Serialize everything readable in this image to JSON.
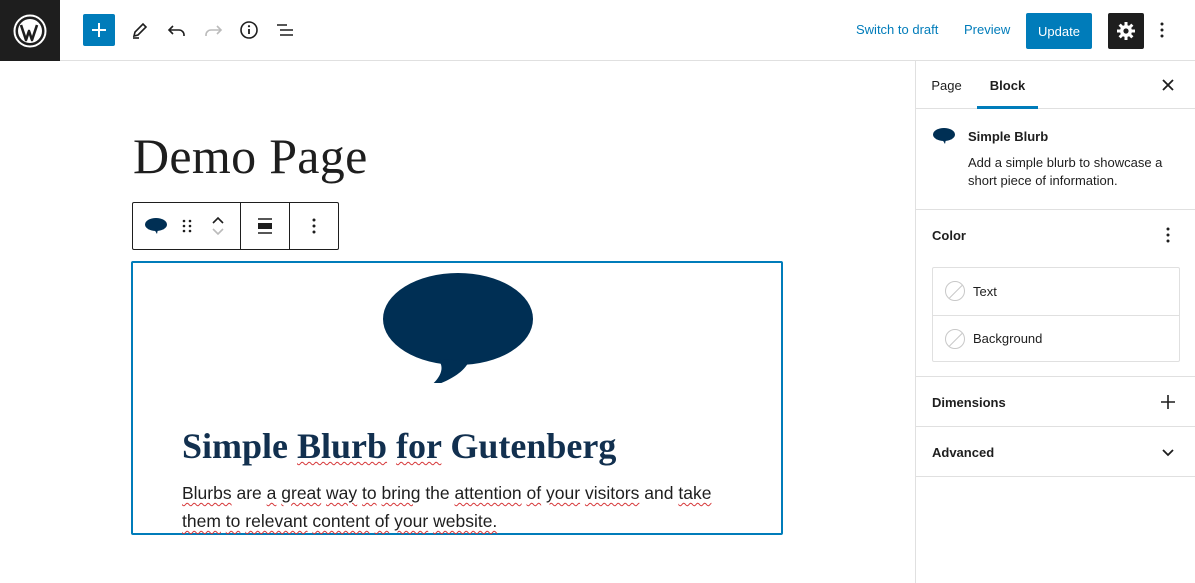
{
  "topbar": {
    "logo_icon": "wordpress-logo-icon",
    "add_icon": "plus-icon",
    "tools_icon": "pencil-icon",
    "undo_icon": "undo-icon",
    "redo_icon": "redo-icon",
    "details_icon": "info-icon",
    "outline_icon": "list-view-icon",
    "switch_to_draft": "Switch to draft",
    "preview": "Preview",
    "update": "Update",
    "settings_icon": "gear-icon",
    "more_icon": "vertical-ellipsis-icon"
  },
  "editor": {
    "page_title": "Demo Page",
    "block_toolbar": {
      "block_icon": "speech-bubble-icon",
      "drag_icon": "drag-handle-icon",
      "move_up_icon": "chevron-up-icon",
      "move_down_icon": "chevron-down-icon",
      "align_icon": "align-center-icon",
      "options_icon": "vertical-ellipsis-icon"
    },
    "blurb": {
      "icon": "speech-bubble-icon",
      "icon_color": "#002f54",
      "title_words": [
        "Simple",
        "Blurb",
        "for",
        "Gutenberg"
      ],
      "text_words": [
        "Blurbs",
        "are",
        "a",
        "great",
        "way",
        "to",
        "bring",
        "the",
        "attention",
        "of",
        "your",
        "visitors",
        "and",
        "take",
        "them",
        "to",
        "relevant",
        "content",
        "of",
        "your",
        "website."
      ]
    }
  },
  "sidebar": {
    "tabs": [
      {
        "label": "Page",
        "active": false
      },
      {
        "label": "Block",
        "active": true
      }
    ],
    "close_icon": "close-icon",
    "block_card": {
      "icon": "speech-bubble-icon",
      "title": "Simple Blurb",
      "description": "Add a simple blurb to showcase a short piece of information."
    },
    "color_panel": {
      "title": "Color",
      "menu_icon": "vertical-ellipsis-icon",
      "items": [
        {
          "label": "Text"
        },
        {
          "label": "Background"
        }
      ]
    },
    "dimensions_panel": {
      "title": "Dimensions",
      "icon": "plus-icon"
    },
    "advanced_panel": {
      "title": "Advanced",
      "icon": "chevron-down-icon"
    }
  },
  "colors": {
    "accent": "#007cba",
    "dark": "#1e1e1e",
    "blurb_title": "#12304f"
  }
}
